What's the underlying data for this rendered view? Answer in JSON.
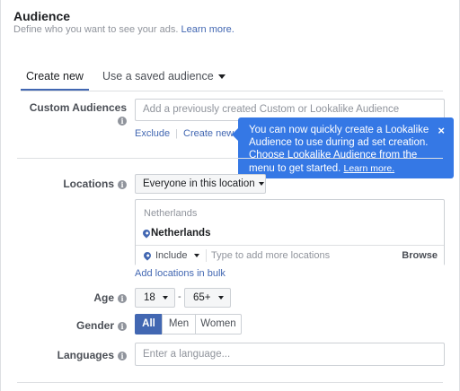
{
  "header": {
    "title": "Audience",
    "subtitle": "Define who you want to see your ads.",
    "learn_more": "Learn more."
  },
  "tabs": [
    {
      "label": "Create new",
      "active": true
    },
    {
      "label": "Use a saved audience",
      "active": false
    }
  ],
  "custom_audiences": {
    "label": "Custom Audiences",
    "placeholder": "Add a previously created Custom or Lookalike Audience",
    "exclude": "Exclude",
    "create_new": "Create new"
  },
  "tooltip": {
    "text": "You can now quickly create a Lookalike Audience to use during ad set creation. Choose Lookalike Audience from the menu to get started.",
    "link": "Learn more.",
    "close": "×"
  },
  "locations": {
    "label": "Locations",
    "dropdown": "Everyone in this location",
    "country_heading": "Netherlands",
    "country": "Netherlands",
    "include": "Include",
    "placeholder": "Type to add more locations",
    "browse": "Browse",
    "bulk_link": "Add locations in bulk"
  },
  "age": {
    "label": "Age",
    "min": "18",
    "separator": "-",
    "max": "65+"
  },
  "gender": {
    "label": "Gender",
    "options": [
      "All",
      "Men",
      "Women"
    ],
    "selected": "All"
  },
  "languages": {
    "label": "Languages",
    "placeholder": "Enter a language..."
  },
  "colors": {
    "accent": "#4267b2",
    "tooltip_bg": "#3578e5",
    "info_icon": "#90949c"
  }
}
